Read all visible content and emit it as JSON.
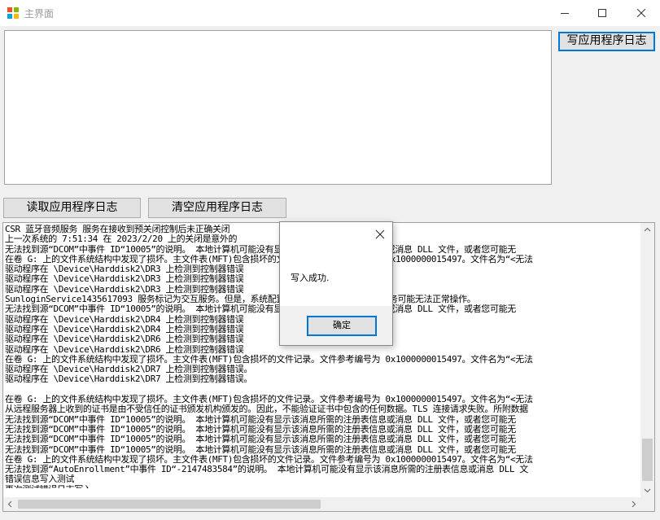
{
  "window": {
    "title": "主界面"
  },
  "buttons": {
    "write_log": "写应用程序日志",
    "read_log": "读取应用程序日志",
    "clear_log": "清空应用程序日志"
  },
  "input": {
    "value": ""
  },
  "log": {
    "lines": [
      "CSR 蓝牙音频服务 服务在接收到预关闭控制后未正确关闭",
      "上一次系统的 7:51:34 在 2023/2/20 上的关闭是意外的",
      "无法找到源“DCOM”中事件 ID“10005”的说明。 本地计算机可能没有显示该消息所需的注册表信息或消息 DLL 文件，或者您可能无",
      "在卷 G: 上的文件系统结构中发现了损坏。主文件表(MFT)包含损坏的文件记录。文件参考编号为 0x1000000015497。文件名为“<无法",
      "驱动程序在 \\Device\\Harddisk2\\DR3 上检测到控制器错误",
      "驱动程序在 \\Device\\Harddisk2\\DR3 上检测到控制器错误",
      "驱动程序在 \\Device\\Harddisk2\\DR3 上检测到控制器错误",
      "SunloginService1435617093 服务标记为交互服务。但是，系统配置为不允许交互服务。这项服务可能无法正常操作。",
      "无法找到源“DCOM”中事件 ID“10005”的说明。 本地计算机可能没有显示该消息所需的注册表信息或消息 DLL 文件，或者您可能无",
      "驱动程序在 \\Device\\Harddisk2\\DR4 上检测到控制器错误",
      "驱动程序在 \\Device\\Harddisk2\\DR4 上检测到控制器错误",
      "驱动程序在 \\Device\\Harddisk2\\DR6 上检测到控制器错误",
      "驱动程序在 \\Device\\Harddisk2\\DR6 上检测到控制器错误",
      "在卷 G: 上的文件系统结构中发现了损坏。主文件表(MFT)包含损坏的文件记录。文件参考编号为 0x1000000015497。文件名为“<无法",
      "驱动程序在 \\Device\\Harddisk2\\DR7 上检测到控制器错误。",
      "驱动程序在 \\Device\\Harddisk2\\DR7 上检测到控制器错误。",
      "",
      "在卷 G: 上的文件系统结构中发现了损坏。主文件表(MFT)包含损坏的文件记录。文件参考编号为 0x1000000015497。文件名为“<无法",
      "从远程服务器上收到的证书是由不受信任的证书颁发机构颁发的。因此，不能验证证书中包含的任何数据。TLS 连接请求失败。所附数据",
      "无法找到源“DCOM”中事件 ID“10005”的说明。 本地计算机可能没有显示该消息所需的注册表信息或消息 DLL 文件，或者您可能无",
      "无法找到源“DCOM”中事件 ID“10005”的说明。 本地计算机可能没有显示该消息所需的注册表信息或消息 DLL 文件，或者您可能无",
      "无法找到源“DCOM”中事件 ID“10005”的说明。 本地计算机可能没有显示该消息所需的注册表信息或消息 DLL 文件，或者您可能无",
      "无法找到源“DCOM”中事件 ID“10005”的说明。 本地计算机可能没有显示该消息所需的注册表信息或消息 DLL 文件，或者您可能无",
      "在卷 G: 上的文件系统结构中发现了损坏。主文件表(MFT)包含损坏的文件记录。文件参考编号为 0x1000000015497。文件名为“<无法",
      "无法找到源“AutoEnrollment”中事件 ID“-2147483584”的说明。 本地计算机可能没有显示该消息所需的注册表信息或消息 DLL 文",
      "错误信息写入测试",
      "再次测试错误日志写入"
    ]
  },
  "dialog": {
    "message": "写入成功.",
    "ok_label": "确定"
  }
}
